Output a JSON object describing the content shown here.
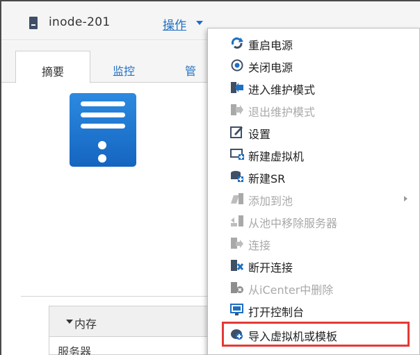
{
  "header": {
    "host_name": "inode-201",
    "operations_label": "操作"
  },
  "tabs": [
    {
      "label": "摘要",
      "active": true
    },
    {
      "label": "监控",
      "active": false
    },
    {
      "label": "管",
      "active": false
    }
  ],
  "memory_panel": {
    "title": "内存",
    "row_label": "服务器"
  },
  "context_menu": {
    "items": [
      {
        "label": "重启电源",
        "icon": "restart-icon",
        "enabled": true
      },
      {
        "label": "关闭电源",
        "icon": "power-off-icon",
        "enabled": true
      },
      {
        "label": "进入维护模式",
        "icon": "enter-maintenance-icon",
        "enabled": true
      },
      {
        "label": "退出维护模式",
        "icon": "exit-maintenance-icon",
        "enabled": false
      },
      {
        "label": "设置",
        "icon": "edit-settings-icon",
        "enabled": true
      },
      {
        "label": "新建虚拟机",
        "icon": "new-vm-icon",
        "enabled": true
      },
      {
        "label": "新建SR",
        "icon": "new-sr-icon",
        "enabled": true
      },
      {
        "label": "添加到池",
        "icon": "add-to-pool-icon",
        "enabled": false,
        "submenu": true
      },
      {
        "label": "从池中移除服务器",
        "icon": "remove-from-pool-icon",
        "enabled": false
      },
      {
        "label": "连接",
        "icon": "connect-icon",
        "enabled": false
      },
      {
        "label": "断开连接",
        "icon": "disconnect-icon",
        "enabled": true
      },
      {
        "label": "从iCenter中删除",
        "icon": "delete-from-icenter-icon",
        "enabled": false
      },
      {
        "label": "打开控制台",
        "icon": "console-icon",
        "enabled": true
      },
      {
        "label": "导入虚拟机或模板",
        "icon": "import-vm-icon",
        "enabled": true,
        "highlighted": true
      }
    ]
  },
  "colors": {
    "link_blue": "#1f6fc2",
    "server_blue": "#1e7ad6",
    "highlight_red": "#e53935",
    "disabled_text": "#a9a9a9"
  }
}
